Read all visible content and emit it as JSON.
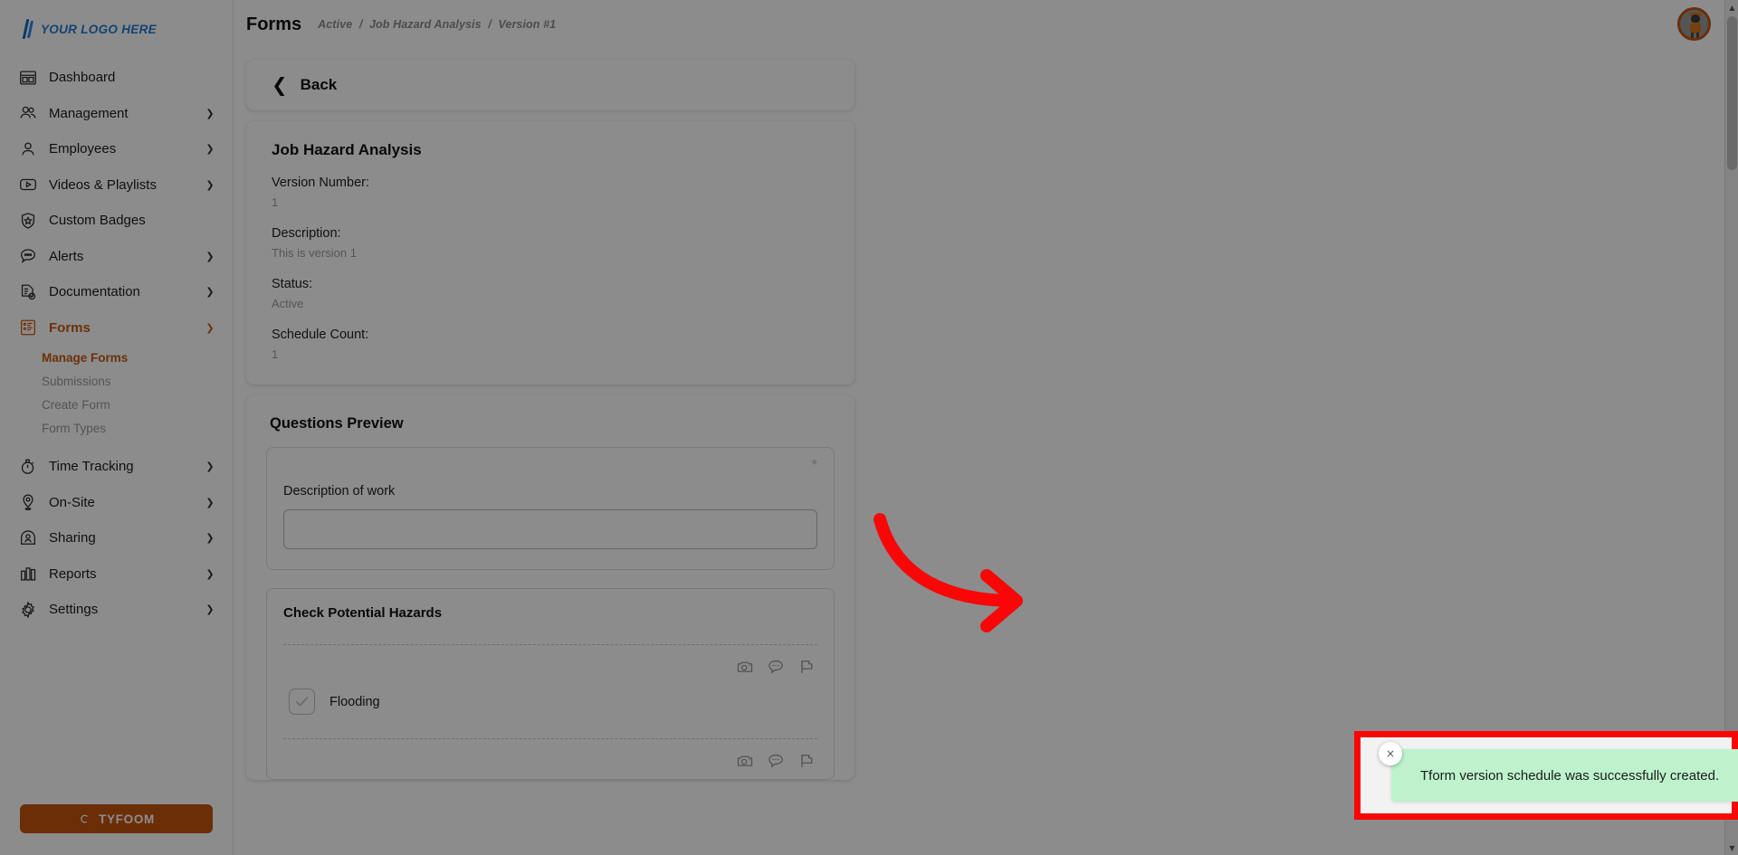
{
  "brand": {
    "logo_text": "YOUR LOGO HERE",
    "footer_button": "TYFOOM",
    "accent_color": "#c4540c",
    "logo_color": "#1f7ad1"
  },
  "sidebar": {
    "items": [
      {
        "label": "Dashboard",
        "icon": "dashboard-icon",
        "expandable": false,
        "active": false
      },
      {
        "label": "Management",
        "icon": "users-icon",
        "expandable": true,
        "active": false
      },
      {
        "label": "Employees",
        "icon": "user-icon",
        "expandable": true,
        "active": false
      },
      {
        "label": "Videos & Playlists",
        "icon": "video-icon",
        "expandable": true,
        "active": false
      },
      {
        "label": "Custom Badges",
        "icon": "badge-shield-icon",
        "expandable": false,
        "active": false
      },
      {
        "label": "Alerts",
        "icon": "chat-alert-icon",
        "expandable": true,
        "active": false
      },
      {
        "label": "Documentation",
        "icon": "document-check-icon",
        "expandable": true,
        "active": false
      },
      {
        "label": "Forms",
        "icon": "forms-list-icon",
        "expandable": true,
        "active": true
      }
    ],
    "forms_subitems": [
      {
        "label": "Manage Forms",
        "active": true
      },
      {
        "label": "Submissions",
        "active": false
      },
      {
        "label": "Create Form",
        "active": false
      },
      {
        "label": "Form Types",
        "active": false
      }
    ],
    "items_after": [
      {
        "label": "Time Tracking",
        "icon": "stopwatch-icon",
        "expandable": true
      },
      {
        "label": "On-Site",
        "icon": "map-pin-icon",
        "expandable": true
      },
      {
        "label": "Sharing",
        "icon": "share-user-icon",
        "expandable": true
      },
      {
        "label": "Reports",
        "icon": "bar-chart-icon",
        "expandable": true
      },
      {
        "label": "Settings",
        "icon": "gear-icon",
        "expandable": true
      }
    ]
  },
  "header": {
    "title": "Forms",
    "breadcrumb": {
      "status": "Active",
      "sep1": "/",
      "form": "Job Hazard Analysis",
      "sep2": "/",
      "version": "Version #1"
    }
  },
  "main": {
    "back_label": "Back",
    "info": {
      "title": "Job Hazard Analysis",
      "fields": [
        {
          "label": "Version Number:",
          "value": "1"
        },
        {
          "label": "Description:",
          "value": "This is version 1"
        },
        {
          "label": "Status:",
          "value": "Active"
        },
        {
          "label": "Schedule Count:",
          "value": "1"
        }
      ]
    },
    "questions_preview": {
      "title": "Questions Preview",
      "questions": [
        {
          "type": "text",
          "required_marker": "*",
          "label": "Description of work",
          "input_value": "",
          "input_placeholder": ""
        },
        {
          "type": "checkbox-group",
          "label": "Check Potential Hazards",
          "options": [
            {
              "label": "Flooding",
              "checked": true
            }
          ],
          "row_icons": [
            "camera-icon",
            "comment-icon",
            "flag-icon"
          ]
        }
      ]
    }
  },
  "toast": {
    "message": "Tform version schedule was successfully created.",
    "close_label": "×",
    "background_color": "#bdf2cd",
    "highlight_color": "#f90606"
  },
  "annotations": {
    "arrow_color": "#f90606"
  }
}
